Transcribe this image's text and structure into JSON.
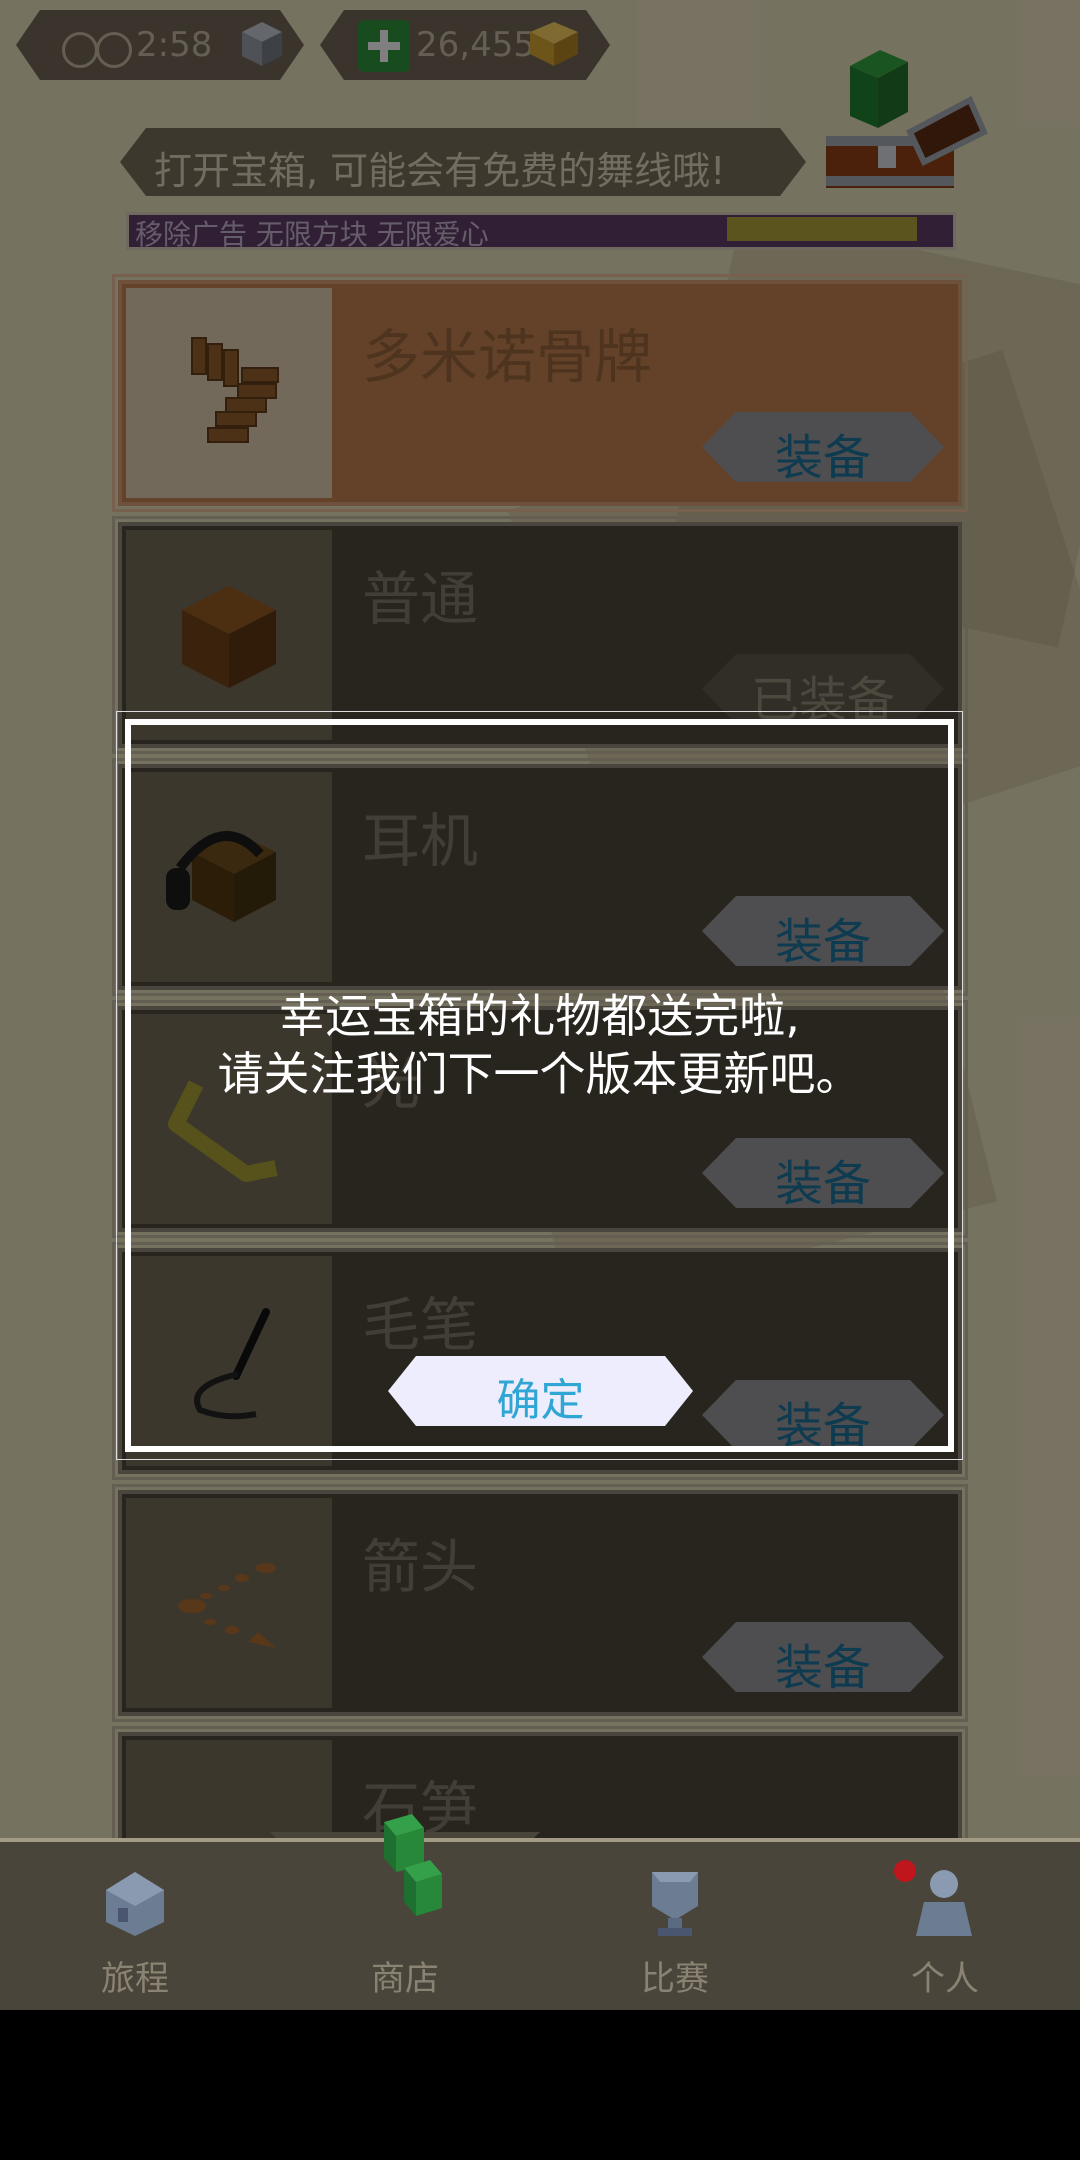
{
  "topbar": {
    "timer": "2:58",
    "currency": "26,455"
  },
  "banner": {
    "text": "打开宝箱, 可能会有免费的舞线哦!"
  },
  "promo": {
    "text": "移除广告  无限方块  无限爱心"
  },
  "items": [
    {
      "name": "多米诺骨牌",
      "button": "装备",
      "selected": true,
      "icon": "domino-icon"
    },
    {
      "name": "普通",
      "button": "已装备",
      "selected": false,
      "icon": "brown-cube-icon"
    },
    {
      "name": "耳机",
      "button": "装备",
      "selected": false,
      "icon": "headphones-cube-icon"
    },
    {
      "name": "光",
      "button": "装备",
      "selected": false,
      "icon": "light-trail-icon"
    },
    {
      "name": "毛笔",
      "button": "装备",
      "selected": false,
      "icon": "brush-icon"
    },
    {
      "name": "箭头",
      "button": "装备",
      "selected": false,
      "icon": "arrow-dots-icon"
    },
    {
      "name": "石笋",
      "button": "",
      "selected": false,
      "icon": "stalagmite-icon"
    }
  ],
  "dialog": {
    "line1": "幸运宝箱的礼物都送完啦,",
    "line2": "请关注我们下一个版本更新吧。",
    "confirm": "确定"
  },
  "nav": {
    "journey": "旅程",
    "shop": "商店",
    "match": "比赛",
    "profile": "个人"
  },
  "colors": {
    "accent_blue": "#2fa6d3",
    "selected_card": "#b5794c",
    "nav_bg": "#4a453a",
    "notification": "#c0151c"
  }
}
